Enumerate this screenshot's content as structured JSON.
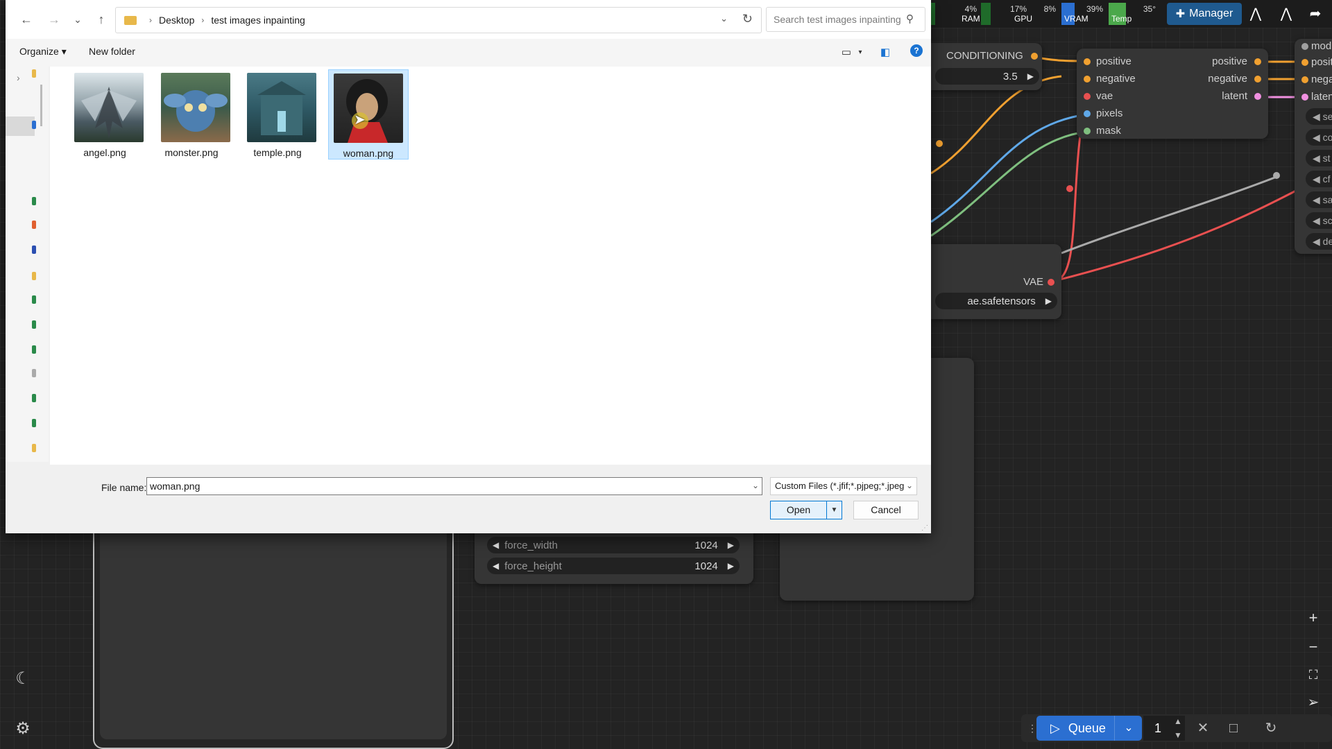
{
  "canvas": {
    "conditioning_label": "CONDITIONING",
    "guidance_value": "3.5",
    "inpaint_inputs": [
      "positive",
      "negative",
      "vae",
      "pixels",
      "mask"
    ],
    "inpaint_outputs": [
      "positive",
      "negative",
      "latent"
    ],
    "right_inputs": [
      "mod",
      "posit",
      "nega",
      "laten"
    ],
    "right_widgets": [
      "se",
      "co",
      "st",
      "cf",
      "sa",
      "sc",
      "de"
    ],
    "vae_label": "VAE",
    "vae_file": "ae.safetensors",
    "force_width": {
      "name": "force_width",
      "value": "1024"
    },
    "force_height": {
      "name": "force_height",
      "value": "1024"
    }
  },
  "topbar": {
    "meters": [
      {
        "label": "RAM",
        "pct": "4%",
        "level": 0.04,
        "color": "#1f6b2a"
      },
      {
        "label": "GPU",
        "pct": "17%",
        "level": 0.17,
        "color": "#1f6b2a"
      },
      {
        "label": "VRAM",
        "pct": "8%",
        "level": 0.08,
        "color": "#2b6fd1"
      },
      {
        "label": "Temp",
        "pct": "39%",
        "level": 0.39,
        "color": "#4ba84b"
      },
      {
        "label": "",
        "pct": "35°",
        "level": 0.35,
        "color": "#c04a4a"
      }
    ],
    "manager_label": "Manager"
  },
  "queue": {
    "label": "Queue",
    "count": "1"
  },
  "dialog": {
    "breadcrumb": [
      "Desktop",
      "test images inpainting"
    ],
    "search_placeholder": "Search test images inpainting",
    "organize_label": "Organize ▾",
    "new_folder_label": "New folder",
    "files": [
      {
        "name": "angel.png",
        "colors": [
          "#d9e2e8",
          "#4a5a63",
          "#2a3a2e"
        ]
      },
      {
        "name": "monster.png",
        "colors": [
          "#3b5a4a",
          "#4d7fb0",
          "#8a6a4a"
        ]
      },
      {
        "name": "temple.png",
        "colors": [
          "#2f5a66",
          "#7fb2c2",
          "#1f3a3e"
        ]
      },
      {
        "name": "woman.png",
        "colors": [
          "#2a2a2a",
          "#c9a27a",
          "#c8282a"
        ]
      }
    ],
    "selected_file": "woman.png",
    "filename_label": "File name:",
    "filename_value": "woman.png",
    "filter_label": "Custom Files (*.jfif;*.pjpeg;*.jpeg",
    "open_label": "Open",
    "cancel_label": "Cancel"
  }
}
